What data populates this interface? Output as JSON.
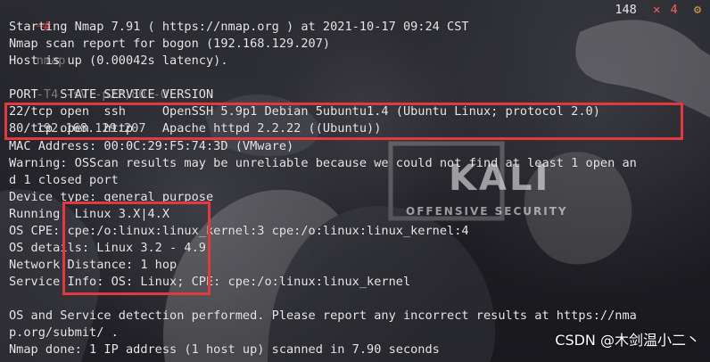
{
  "terminal": {
    "prompt": {
      "arrow": "─#",
      "command": "nmap",
      "arguments": "-T4 -sV -p22,80 -O",
      "target": "192.168.129.207"
    },
    "status": {
      "count": "148",
      "x": "✕",
      "error_count": "4",
      "gear": "⚙"
    },
    "lines": [
      "Starting Nmap 7.91 ( https://nmap.org ) at 2021-10-17 09:24 CST",
      "Nmap scan report for bogon (192.168.129.207)",
      "Host is up (0.00042s latency).",
      "",
      "PORT   STATE SERVICE VERSION",
      "22/tcp open  ssh     OpenSSH 5.9p1 Debian 5ubuntu1.4 (Ubuntu Linux; protocol 2.0)",
      "80/tcp open  http    Apache httpd 2.2.22 ((Ubuntu))",
      "MAC Address: 00:0C:29:F5:74:3D (VMware)",
      "Warning: OSScan results may be unreliable because we could not find at least 1 open an",
      "d 1 closed port",
      "Device type: general purpose",
      "Running: Linux 3.X|4.X",
      "OS CPE: cpe:/o:linux:linux_kernel:3 cpe:/o:linux:linux_kernel:4",
      "OS details: Linux 3.2 - 4.9",
      "Network Distance: 1 hop",
      "Service Info: OS: Linux; CPE: cpe:/o:linux:linux_kernel",
      "",
      "OS and Service detection performed. Please report any incorrect results at https://nma",
      "p.org/submit/ .",
      "Nmap done: 1 IP address (1 host up) scanned in 7.90 seconds"
    ]
  },
  "background": {
    "logo_text": "KALI",
    "slogan": "OFFENSIVE SECURITY"
  },
  "watermark": "CSDN @木剑温小二丶",
  "colors": {
    "background": "#1e1e24",
    "text": "#e7e7e7",
    "prompt_gray": "#7f7f7f",
    "highlight_red": "#e3383f",
    "error_red": "#ff5f5f",
    "gear_orange": "#e0a23a"
  }
}
